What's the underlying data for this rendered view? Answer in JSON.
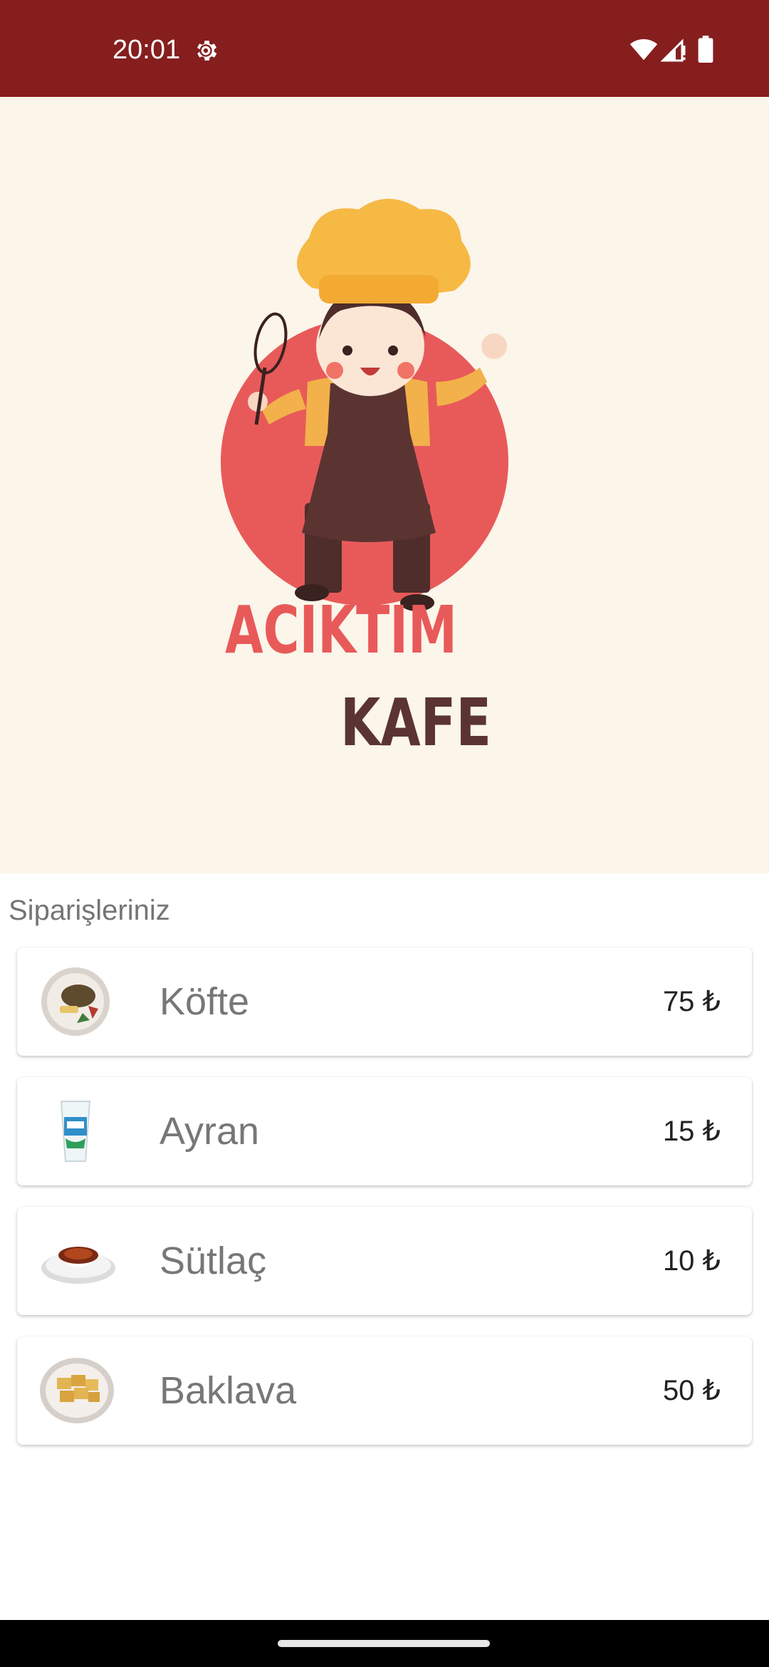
{
  "status_bar": {
    "time": "20:01",
    "icons": [
      "settings-gear-icon",
      "wifi-icon",
      "signal-icon",
      "battery-icon"
    ]
  },
  "hero": {
    "logo_line1": "ACIKTIM",
    "logo_line2": "KAFE",
    "logo_colors": {
      "red": "#e85a5a",
      "brown": "#5b3431",
      "hat": "#f6b944",
      "background": "#fbf5ea"
    }
  },
  "orders": {
    "title": "Siparişleriniz",
    "items": [
      {
        "name": "Köfte",
        "price": "75 ₺",
        "image": "kofte-plate"
      },
      {
        "name": "Ayran",
        "price": "15 ₺",
        "image": "ayran-cup"
      },
      {
        "name": "Sütlaç",
        "price": "10 ₺",
        "image": "sutlac-bowl"
      },
      {
        "name": "Baklava",
        "price": "50 ₺",
        "image": "baklava-plate"
      }
    ]
  },
  "theme": {
    "primary": "#861e1e"
  }
}
